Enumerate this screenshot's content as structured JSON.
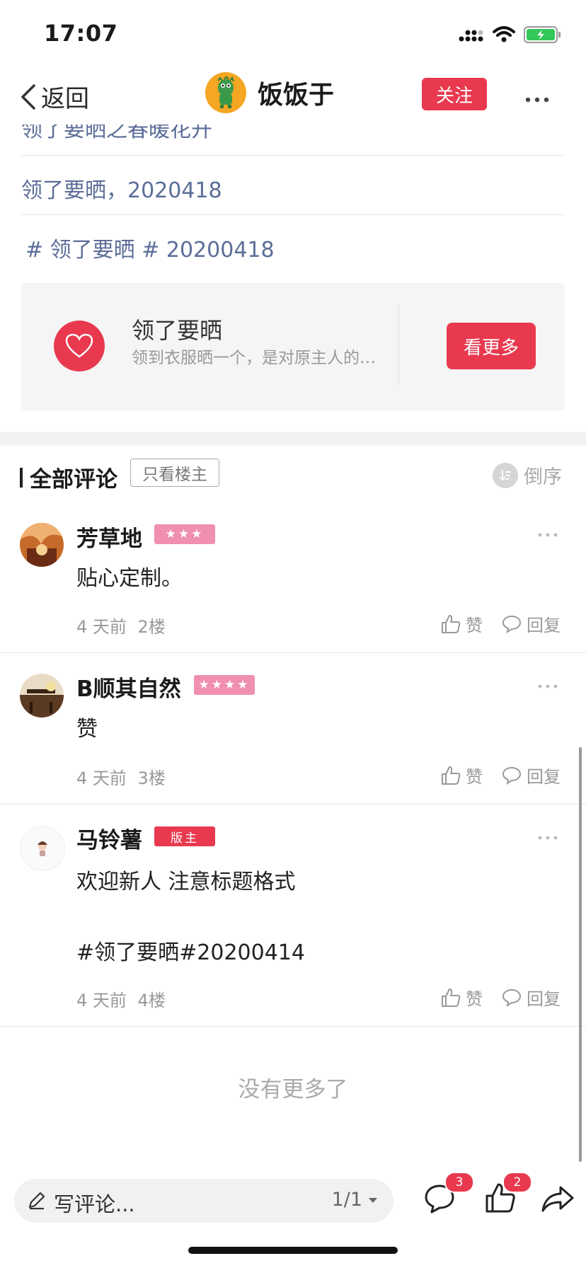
{
  "status_bar": {
    "time": "17:07"
  },
  "nav": {
    "back_label": "返回",
    "user_name": "饭饭于",
    "follow_label": "关注"
  },
  "tags": {
    "partial": "领了要晒之春暖花开",
    "line1": "领了要晒，2020418",
    "line2": "# 领了要晒 # 20200418"
  },
  "card": {
    "title": "领了要晒",
    "description": "领到衣服晒一个，是对原主人的最好回馈",
    "button_label": "看更多"
  },
  "comments_header": {
    "title": "全部评论",
    "only_op_label": "只看楼主",
    "sort_label": "倒序"
  },
  "comments": [
    {
      "user": "芳草地",
      "badge": "★★★",
      "badge_color": "#f08fae",
      "text": "贴心定制。",
      "time": "4 天前",
      "floor": "2楼",
      "like_label": "赞",
      "reply_label": "回复"
    },
    {
      "user": "B顺其自然",
      "badge": "★★★★",
      "badge_color": "#f08fae",
      "text": "赞",
      "time": "4 天前",
      "floor": "3楼",
      "like_label": "赞",
      "reply_label": "回复"
    },
    {
      "user": "马铃薯",
      "badge": "版主",
      "badge_color": "#e8394f",
      "text_line1": "欢迎新人 注意标题格式",
      "text_line2": "#领了要晒#20200414",
      "time": "4 天前",
      "floor": "4楼",
      "like_label": "赞",
      "reply_label": "回复"
    }
  ],
  "no_more_label": "没有更多了",
  "bottom_bar": {
    "comment_placeholder": "写评论...",
    "page_indicator": "1/1",
    "comment_count": "3",
    "like_count": "2"
  },
  "colors": {
    "accent": "#e8394f",
    "tag_blue": "#5b6d98"
  },
  "icons": [
    "signal-icon",
    "wifi-icon",
    "battery-charging-icon",
    "back-chevron-icon",
    "more-icon",
    "heart-icon",
    "sort-icon",
    "thumb-up-icon",
    "reply-bubble-icon",
    "pencil-icon",
    "caret-down-icon",
    "comment-icon",
    "like-icon",
    "share-icon"
  ]
}
